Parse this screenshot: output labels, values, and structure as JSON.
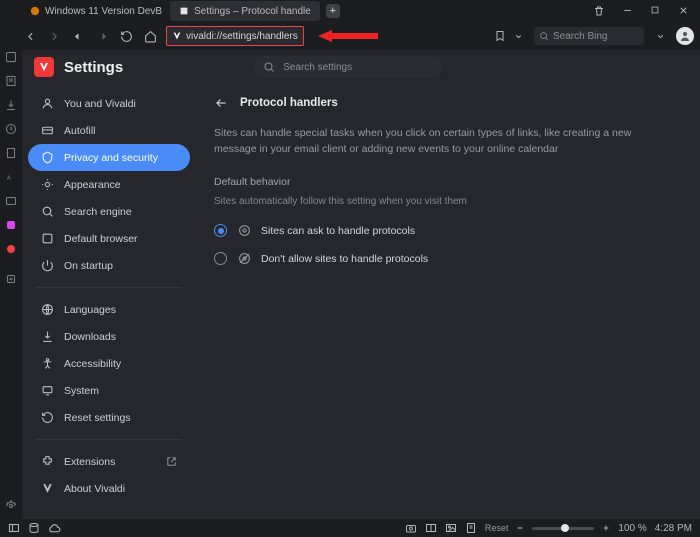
{
  "window": {
    "tabs": [
      {
        "title": "Windows 11 Version DevB"
      },
      {
        "title": "Settings – Protocol handle"
      }
    ]
  },
  "addressbar": {
    "url": "vivaldi://settings/handlers",
    "search_placeholder": "Search Bing"
  },
  "settings": {
    "title": "Settings",
    "search_placeholder": "Search settings",
    "sidebar": [
      {
        "label": "You and Vivaldi",
        "icon": "person"
      },
      {
        "label": "Autofill",
        "icon": "autofill"
      },
      {
        "label": "Privacy and security",
        "icon": "shield",
        "active": true
      },
      {
        "label": "Appearance",
        "icon": "appearance"
      },
      {
        "label": "Search engine",
        "icon": "search"
      },
      {
        "label": "Default browser",
        "icon": "default"
      },
      {
        "label": "On startup",
        "icon": "power"
      },
      {
        "divider": true
      },
      {
        "label": "Languages",
        "icon": "globe"
      },
      {
        "label": "Downloads",
        "icon": "download"
      },
      {
        "label": "Accessibility",
        "icon": "accessibility"
      },
      {
        "label": "System",
        "icon": "system"
      },
      {
        "label": "Reset settings",
        "icon": "reset"
      },
      {
        "divider": true
      },
      {
        "label": "Extensions",
        "icon": "extension",
        "external": true
      },
      {
        "label": "About Vivaldi",
        "icon": "vivaldi"
      }
    ]
  },
  "page": {
    "title": "Protocol handlers",
    "description": "Sites can handle special tasks when you click on certain types of links, like creating a new message in your email client or adding new events to your online calendar",
    "section_label": "Default behavior",
    "section_hint": "Sites automatically follow this setting when you visit them",
    "options": [
      {
        "label": "Sites can ask to handle protocols",
        "checked": true
      },
      {
        "label": "Don't allow sites to handle protocols",
        "checked": false
      }
    ]
  },
  "statusbar": {
    "reset_label": "Reset",
    "zoom": "100 %",
    "time": "4:28 PM"
  }
}
